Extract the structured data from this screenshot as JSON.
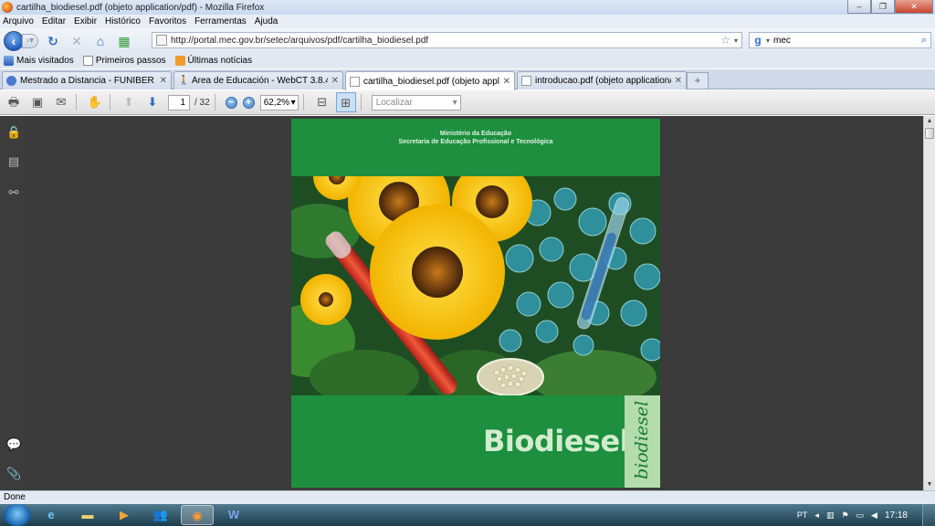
{
  "window": {
    "title": "cartilha_biodiesel.pdf (objeto application/pdf) - Mozilla Firefox",
    "minimize": "–",
    "maximize": "❐",
    "close": "✕"
  },
  "menu": [
    "Arquivo",
    "Editar",
    "Exibir",
    "Histórico",
    "Favoritos",
    "Ferramentas",
    "Ajuda"
  ],
  "nav": {
    "url": "http://portal.mec.gov.br/setec/arquivos/pdf/cartilha_biodiesel.pdf",
    "search_query": "mec",
    "search_engine_icon": "google-icon"
  },
  "bookmarks": [
    "Mais visitados",
    "Primeiros passos",
    "Últimas notícias"
  ],
  "tabs": [
    {
      "label": "Mestrado a Distancia - FUNIBER",
      "active": false
    },
    {
      "label": "Área de Educación - WebCT 3.8.4",
      "active": false
    },
    {
      "label": "cartilha_biodiesel.pdf (objeto appl...",
      "active": true
    },
    {
      "label": "introducao.pdf (objeto application/...",
      "active": false
    }
  ],
  "pdf_toolbar": {
    "page": "1",
    "total": "/ 32",
    "zoom": "62,2%",
    "find_placeholder": "Localizar"
  },
  "pdf_page": {
    "ministry_line1": "Ministério da Educação",
    "ministry_line2": "Secretaria de Educação Profissional e Tecnológica",
    "title": "Biodiesel",
    "side_text": "biodiesel"
  },
  "status": "Done",
  "tray": {
    "lang": "PT",
    "time": "17:18"
  },
  "colors": {
    "cover_green": "#1d8f3e",
    "cover_light_green": "#b4dcac",
    "viewer_bg": "#3b3b3b"
  }
}
